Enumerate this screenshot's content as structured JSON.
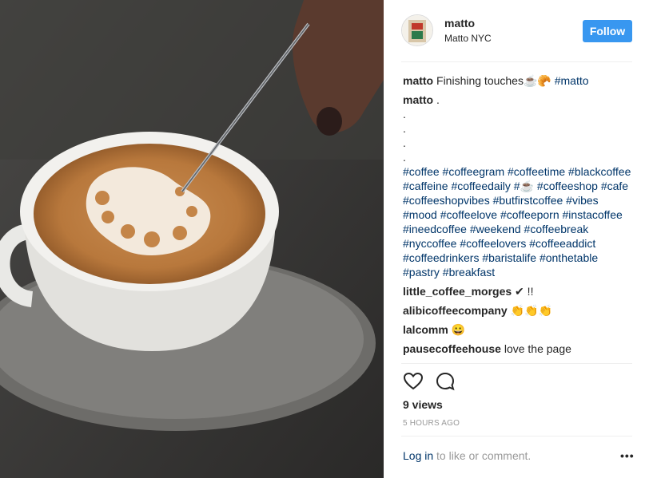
{
  "post": {
    "username": "matto",
    "location": "Matto NYC",
    "follow_label": "Follow",
    "caption_text": "Finishing touches☕🥐 ",
    "caption_tag": "#matto",
    "second_author": "matto",
    "second_text": " .",
    "dots": [
      ".",
      ".",
      ".",
      "."
    ],
    "hashtags": "#coffee #coffeegram #coffeetime #blackcoffee #caffeine #coffeedaily #☕ #coffeeshop #cafe #coffeeshopvibes #butfirstcoffee #vibes #mood #coffeelove #coffeeporn #instacoffee #ineedcoffee #weekend #coffeebreak #nyccoffee #coffeelovers #coffeeaddict #coffeedrinkers #baristalife #onthetable #pastry #breakfast",
    "comments": [
      {
        "user": "little_coffee_morges",
        "text": " ✔ !!"
      },
      {
        "user": "alibicoffeecompany",
        "text": " 👏👏👏"
      },
      {
        "user": "lalcomm",
        "text": " 😀"
      },
      {
        "user": "pausecoffeehouse",
        "text": " love the page"
      }
    ],
    "views": "9 views",
    "time": "5 HOURS AGO",
    "login_link": "Log in",
    "login_rest": " to like or comment.",
    "more_label": "•••"
  },
  "icons": {
    "like": "heart-outline-icon",
    "comment": "speech-bubble-icon",
    "more": "ellipsis-icon"
  },
  "colors": {
    "follow_button": "#3897f0",
    "hashtag": "#003569",
    "muted": "#999999",
    "text": "#262626"
  }
}
